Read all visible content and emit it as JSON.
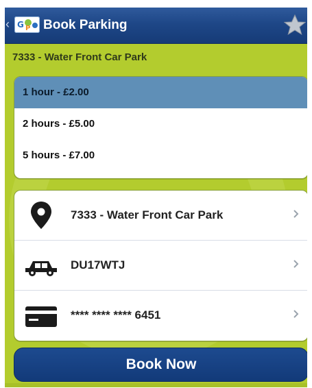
{
  "header": {
    "title": "Book Parking",
    "icons": [
      "back-chevron-icon",
      "app-logo-icon",
      "favorite-star-icon"
    ]
  },
  "carpark": {
    "name": "7333 - Water Front Car Park"
  },
  "durations": [
    {
      "label": "1 hour - £2.00",
      "selected": true
    },
    {
      "label": "2 hours - £5.00",
      "selected": false
    },
    {
      "label": "5 hours - £7.00",
      "selected": false
    }
  ],
  "details": [
    {
      "icon": "location-pin-icon",
      "label": "7333 - Water Front Car Park"
    },
    {
      "icon": "car-icon",
      "label": "DU17WTJ"
    },
    {
      "icon": "credit-card-icon",
      "label": "**** **** **** 6451"
    }
  ],
  "actions": {
    "book_label": "Book Now"
  },
  "colors": {
    "background": "#b3cc2e",
    "header": "#1e4787",
    "selected": "#5f8fb7",
    "button": "#163f83"
  }
}
